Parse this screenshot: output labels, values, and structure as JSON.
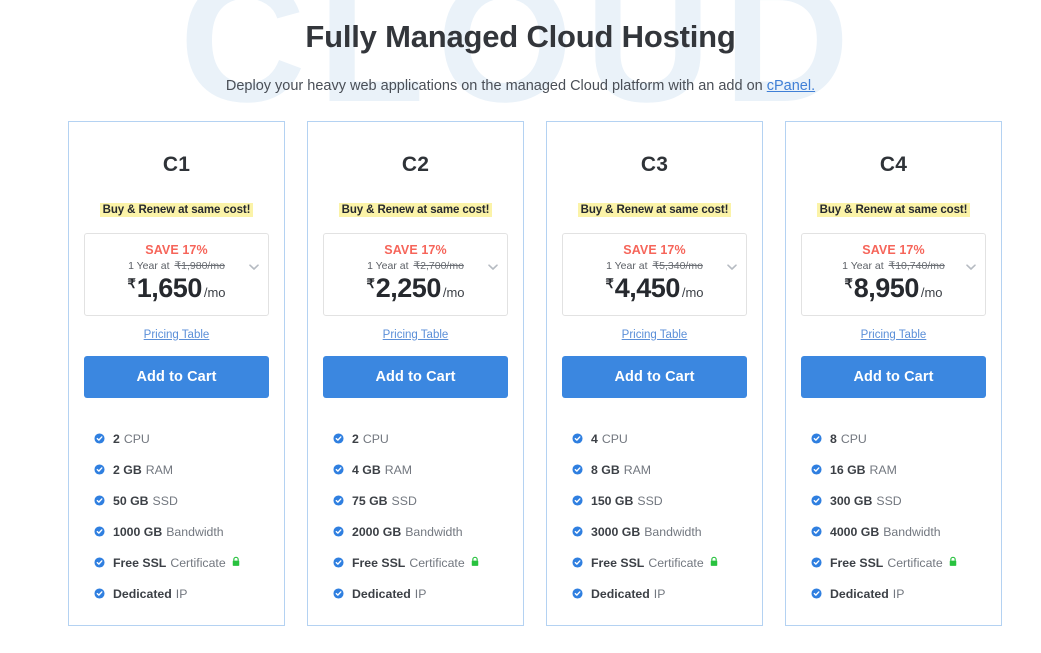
{
  "watermark": {
    "text": "CLOUD",
    "color": "#eaf2f9"
  },
  "header": {
    "title": "Fully Managed Cloud Hosting",
    "subtitle_before": "Deploy your heavy web applications on the managed Cloud platform with an add on ",
    "subtitle_link": "cPanel.",
    "link_color": "#3f7fd6"
  },
  "common": {
    "renew_badge": "Buy & Renew at same cost!",
    "save_label": "SAVE 17%",
    "term_prefix": "1 Year at",
    "rupee": "₹",
    "per_month": "/mo",
    "pricing_table_label": "Pricing Table",
    "cart_label": "Add to Cart",
    "lock_glyph": "🔒",
    "accent_blue": "#3b87e0",
    "save_red": "#f6655a",
    "badge_yellow": "#fbf3a8",
    "card_border": "#b4d2f2",
    "link_blue": "#5b8fd8",
    "lock_green": "#28c23f"
  },
  "plans": [
    {
      "name": "C1",
      "renew_badge": "Buy & Renew at same cost!",
      "save_label": "SAVE 17%",
      "term_prefix": "1 Year at",
      "old_price": "₹1,980/mo",
      "price": "1,650",
      "per_month": "/mo",
      "pricing_table_label": "Pricing Table",
      "cart_label": "Add to Cart",
      "features": [
        {
          "value": "2",
          "label": "CPU",
          "lock": false
        },
        {
          "value": "2 GB",
          "label": "RAM",
          "lock": false
        },
        {
          "value": "50 GB",
          "label": "SSD",
          "lock": false
        },
        {
          "value": "1000 GB",
          "label": "Bandwidth",
          "lock": false
        },
        {
          "value": "Free SSL",
          "label": "Certificate",
          "lock": true
        },
        {
          "value": "Dedicated",
          "label": "IP",
          "lock": false
        }
      ]
    },
    {
      "name": "C2",
      "renew_badge": "Buy & Renew at same cost!",
      "save_label": "SAVE 17%",
      "term_prefix": "1 Year at",
      "old_price": "₹2,700/mo",
      "price": "2,250",
      "per_month": "/mo",
      "pricing_table_label": "Pricing Table",
      "cart_label": "Add to Cart",
      "features": [
        {
          "value": "2",
          "label": "CPU",
          "lock": false
        },
        {
          "value": "4 GB",
          "label": "RAM",
          "lock": false
        },
        {
          "value": "75 GB",
          "label": "SSD",
          "lock": false
        },
        {
          "value": "2000 GB",
          "label": "Bandwidth",
          "lock": false
        },
        {
          "value": "Free SSL",
          "label": "Certificate",
          "lock": true
        },
        {
          "value": "Dedicated",
          "label": "IP",
          "lock": false
        }
      ]
    },
    {
      "name": "C3",
      "renew_badge": "Buy & Renew at same cost!",
      "save_label": "SAVE 17%",
      "term_prefix": "1 Year at",
      "old_price": "₹5,340/mo",
      "price": "4,450",
      "per_month": "/mo",
      "pricing_table_label": "Pricing Table",
      "cart_label": "Add to Cart",
      "features": [
        {
          "value": "4",
          "label": "CPU",
          "lock": false
        },
        {
          "value": "8 GB",
          "label": "RAM",
          "lock": false
        },
        {
          "value": "150 GB",
          "label": "SSD",
          "lock": false
        },
        {
          "value": "3000 GB",
          "label": "Bandwidth",
          "lock": false
        },
        {
          "value": "Free SSL",
          "label": "Certificate",
          "lock": true
        },
        {
          "value": "Dedicated",
          "label": "IP",
          "lock": false
        }
      ]
    },
    {
      "name": "C4",
      "renew_badge": "Buy & Renew at same cost!",
      "save_label": "SAVE 17%",
      "term_prefix": "1 Year at",
      "old_price": "₹10,740/mo",
      "price": "8,950",
      "per_month": "/mo",
      "pricing_table_label": "Pricing Table",
      "cart_label": "Add to Cart",
      "features": [
        {
          "value": "8",
          "label": "CPU",
          "lock": false
        },
        {
          "value": "16 GB",
          "label": "RAM",
          "lock": false
        },
        {
          "value": "300 GB",
          "label": "SSD",
          "lock": false
        },
        {
          "value": "4000 GB",
          "label": "Bandwidth",
          "lock": false
        },
        {
          "value": "Free SSL",
          "label": "Certificate",
          "lock": true
        },
        {
          "value": "Dedicated",
          "label": "IP",
          "lock": false
        }
      ]
    }
  ]
}
